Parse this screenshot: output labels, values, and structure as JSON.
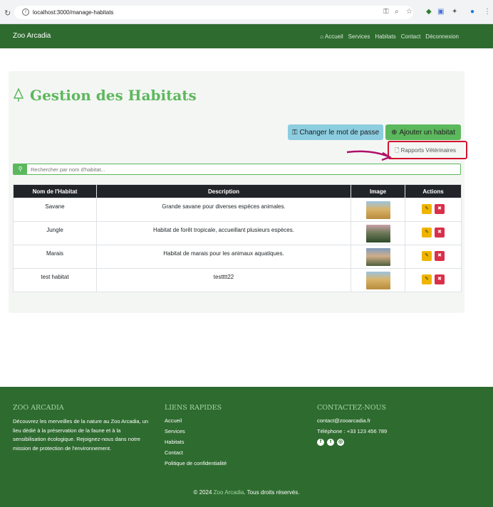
{
  "browser": {
    "url": "localhost:3000/manage-habitats",
    "icons": [
      "key-icon",
      "zoom-icon",
      "star-icon",
      "extension-icon",
      "translate-icon",
      "puzzle-icon",
      "profile-icon",
      "menu-icon"
    ]
  },
  "navbar": {
    "brand": "Zoo Arcadia",
    "links": [
      "Accueil",
      "Services",
      "Habitats",
      "Contact",
      "Déconnexion"
    ]
  },
  "page": {
    "title": "Gestion des Habitats",
    "change_password_label": "Changer le mot de passe",
    "add_habitat_label": "Ajouter un habitat",
    "vet_reports_label": "Rapports Vétérinaires",
    "search_placeholder": "Rechercher par nom d'habitat..."
  },
  "table": {
    "headers": [
      "Nom de l'Habitat",
      "Description",
      "Image",
      "Actions"
    ],
    "rows": [
      {
        "name": "Savane",
        "description": "Grande savane pour diverses espèces animales.",
        "image": "savanna-photo"
      },
      {
        "name": "Jungle",
        "description": "Habitat de forêt tropicale, accueillant plusieurs espèces.",
        "image": "jungle-photo"
      },
      {
        "name": "Marais",
        "description": "Habitat de marais pour les animaux aquatiques.",
        "image": "marsh-photo"
      },
      {
        "name": "test habitat",
        "description": "testttt22",
        "image": "savanna-photo"
      }
    ]
  },
  "footer": {
    "about_title": "ZOO ARCADIA",
    "about_text": "Découvrez les merveilles de la nature au Zoo Arcadia, un lieu dédié à la préservation de la faune et à la sensibilisation écologique. Rejoignez-nous dans notre mission de protection de l'environnement.",
    "links_title": "LIENS RAPIDES",
    "links": [
      "Accueil",
      "Services",
      "Habitats",
      "Contact",
      "Politique de confidentialité"
    ],
    "contact_title": "CONTACTEZ-NOUS",
    "email": "contact@zooarcadia.fr",
    "phone": "Téléphone : +33 123 456 789",
    "copyright_prefix": "© 2024",
    "copyright_brand": "Zoo Arcadia",
    "copyright_suffix": ". Tous droits réservés."
  },
  "colors": {
    "primary_green": "#2e6b2f",
    "accent_green": "#5cb85c",
    "info_blue": "#8ccde0",
    "annotation_red": "#d2122e"
  }
}
